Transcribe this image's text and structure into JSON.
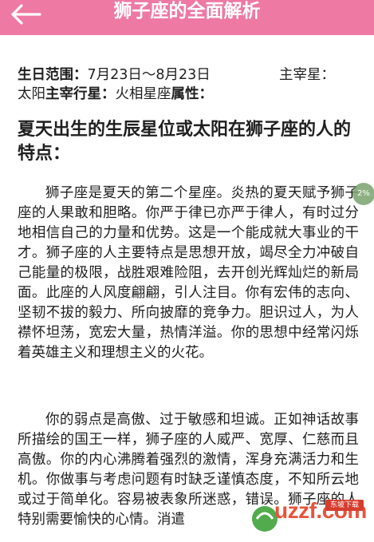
{
  "header": {
    "title": "狮子座的全面解析",
    "back_icon": "arrow-left-icon",
    "background": "#ee79a2"
  },
  "meta": {
    "birthday_label": "生日范围：",
    "birthday_value": "7月23日～8月23日",
    "ruler_label": "主宰星：",
    "sun_prefix": "太阳",
    "planet_label": "主宰行星：",
    "planet_value": "火相星座",
    "attribute_label": "属性："
  },
  "section": {
    "heading": "夏天出生的生辰星位或太阳在狮子座的人的特点：",
    "paragraphs": [
      "狮子座是夏天的第二个星座。炎热的夏天赋予狮子座的人果敢和胆略。你严于律已亦严于律人，有时过分地相信自己的力量和优势。这是一个能成就大事业的干才。狮子座的人主要特点是思想开放，竭尽全力冲破自己能量的极限，战胜艰难险阻，去开创光辉灿烂的新局面。此座的人风度翩翩，引人注目。你有宏伟的志向、坚韧不拔的毅力、所向披靡的竞争力。胆识过人，为人襟怀坦荡，宽宏大量，热情洋溢。你的思想中经常闪烁着英雄主义和理想主义的火花。",
      "你的弱点是高傲、过于敏感和坦诚。正如神话故事所描绘的国王一样，狮子座的人威严、宽厚、仁慈而且高傲。你的内心沸腾着强烈的激情，浑身充满活力和生机。你做事与考虑问题有时缺乏谨慎态度，不知所云地或过于简单化。容易被表象所迷惑，错误。狮子座的人特别需要愉快的心情。消遣"
    ]
  },
  "overlay": {
    "progress_text": "2%",
    "progress_color": "#7aa36e"
  },
  "watermark": {
    "text": "uzzf.com",
    "badge": "东坡下载"
  }
}
